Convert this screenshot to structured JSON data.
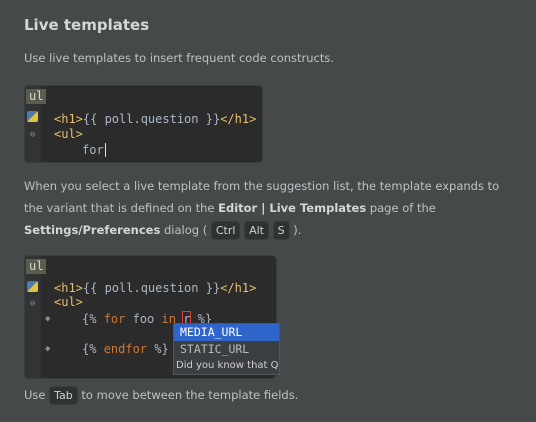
{
  "title": "Live templates",
  "intro": "Use live templates to insert frequent code constructs.",
  "editor1": {
    "typed_prefix": "ul",
    "line1_open": "<h1>",
    "line1_text": "{{ poll.question }}",
    "line1_close": "</h1>",
    "line2": "<ul>",
    "line3": "for"
  },
  "paragraph": {
    "part1": "When you select a live template from the suggestion list, the template expands to the variant that is defined on the ",
    "bold1": "Editor | Live Templates",
    "part2": " page of the ",
    "bold2": "Settings/Preferences",
    "part3": " dialog ( ",
    "key1": "Ctrl",
    "key2": "Alt",
    "key3": "S",
    "part4": " )."
  },
  "editor2": {
    "typed_prefix": "ul",
    "line1_open": "<h1>",
    "line1_text": "{{ poll.question }}",
    "line1_close": "</h1>",
    "line2": "<ul>",
    "line3_a": "{% ",
    "line3_for": "for",
    "line3_b": " foo ",
    "line3_in": "in",
    "line3_sp": " ",
    "line3_var": "r",
    "line3_c": " %}",
    "line4_a": "{% ",
    "line4_endfor": "endfor",
    "line4_b": " %}"
  },
  "completion": {
    "items": [
      "MEDIA_URL",
      "STATIC_URL"
    ],
    "hint": "Did you know that Q"
  },
  "tab_line": {
    "before": "Use ",
    "key": "Tab",
    "after": " to move between the template fields."
  }
}
